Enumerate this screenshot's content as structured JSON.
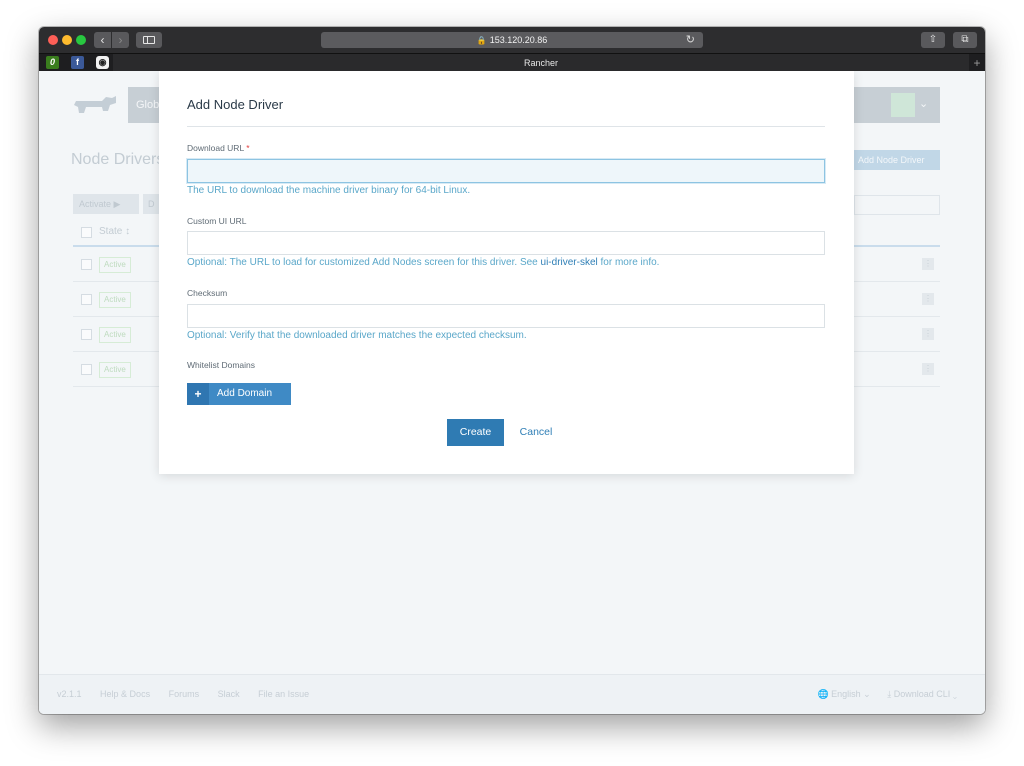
{
  "browser": {
    "address": "153.120.20.86",
    "tab_title": "Rancher",
    "tab_plus": "+",
    "back": "‹",
    "forward": "›",
    "share_glyph": "⇧",
    "tabs_glyph": "⧉",
    "reload_glyph": "↻",
    "lock_glyph": "🔒",
    "favorites": [
      {
        "glyph": "0",
        "icon": "evernote-icon"
      },
      {
        "glyph": "f",
        "icon": "facebook-icon"
      },
      {
        "glyph": "◉",
        "icon": "github-icon"
      }
    ]
  },
  "background": {
    "global_label": "Globl",
    "title": "Node Drivers",
    "add_button": "Add Node Driver",
    "toolbar_activate": "Activate ▶",
    "toolbar_second": "D",
    "header_state": "State ↕",
    "rows": [
      {
        "state": "Active",
        "action": "⋮"
      },
      {
        "state": "Active",
        "action": "⋮"
      },
      {
        "state": "Active",
        "action": "⋮"
      },
      {
        "state": "Active",
        "action": "⋮"
      }
    ],
    "footer_links": [
      "v2.1.1",
      "Help & Docs",
      "Forums",
      "Slack",
      "File an Issue"
    ],
    "footer_language": "🌐 English ⌄",
    "footer_cli": "⤓ Download CLI ⌄"
  },
  "modal": {
    "title": "Add Node Driver",
    "download_url_label": "Download URL",
    "required_mark": "*",
    "download_url_value": "",
    "download_url_help": "The URL to download the machine driver binary for 64-bit Linux.",
    "custom_ui_label": "Custom UI URL",
    "custom_ui_value": "",
    "custom_ui_help_prefix": "Optional: The URL to load for customized Add Nodes screen for this driver. See ",
    "custom_ui_help_link": "ui-driver-skel",
    "custom_ui_help_suffix": " for more info.",
    "checksum_label": "Checksum",
    "checksum_value": "",
    "checksum_help": "Optional: Verify that the downloaded driver matches the expected checksum.",
    "whitelist_label": "Whitelist Domains",
    "add_domain_plus": "+",
    "add_domain_label": "Add Domain",
    "create_label": "Create",
    "cancel_label": "Cancel"
  },
  "colors": {
    "primary": "#2f7bb3",
    "help_text": "#5aa7c9",
    "required": "#e23c3c",
    "active_badge": "#bedbbe"
  }
}
